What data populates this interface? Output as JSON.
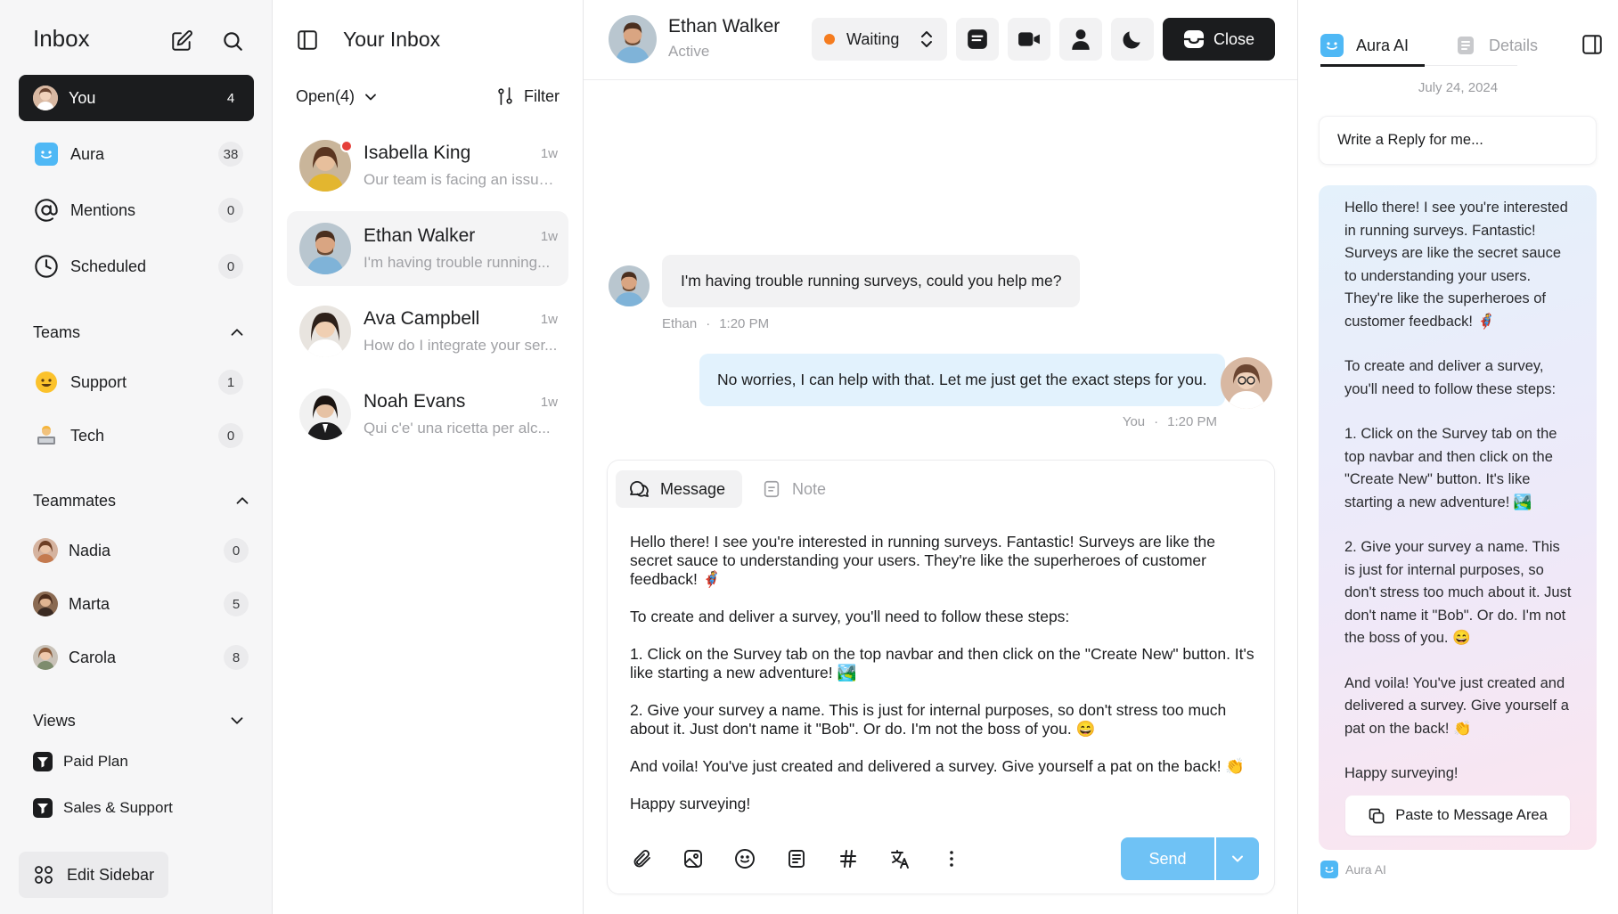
{
  "sidebar": {
    "title": "Inbox",
    "items": [
      {
        "label": "You",
        "count": "4"
      },
      {
        "label": "Aura",
        "count": "38"
      },
      {
        "label": "Mentions",
        "count": "0"
      },
      {
        "label": "Scheduled",
        "count": "0"
      }
    ],
    "teams_label": "Teams",
    "teams": [
      {
        "label": "Support",
        "count": "1"
      },
      {
        "label": "Tech",
        "count": "0"
      }
    ],
    "teammates_label": "Teammates",
    "teammates": [
      {
        "label": "Nadia",
        "count": "0"
      },
      {
        "label": "Marta",
        "count": "5"
      },
      {
        "label": "Carola",
        "count": "8"
      }
    ],
    "views_label": "Views",
    "views": [
      {
        "label": "Paid Plan"
      },
      {
        "label": "Sales & Support"
      }
    ],
    "edit_label": "Edit Sidebar"
  },
  "inbox": {
    "title": "Your Inbox",
    "filter_select": "Open(4)",
    "filter_label": "Filter",
    "conversations": [
      {
        "name": "Isabella King",
        "time": "1w",
        "preview": "Our team is facing an issue..."
      },
      {
        "name": "Ethan Walker",
        "time": "1w",
        "preview": "I'm having trouble running..."
      },
      {
        "name": "Ava Campbell",
        "time": "1w",
        "preview": "How do I integrate your ser..."
      },
      {
        "name": "Noah Evans",
        "time": "1w",
        "preview": "Qui c'e' una ricetta per alc..."
      }
    ]
  },
  "conversation": {
    "contact_name": "Ethan Walker",
    "contact_status": "Active",
    "status_select": "Waiting",
    "close_label": "Close",
    "messages": [
      {
        "text": "I'm having trouble running surveys, could you help me?",
        "sender": "Ethan",
        "time": "1:20 PM"
      },
      {
        "text": "No worries, I can help with that. Let me just get the exact steps for you.",
        "sender": "You",
        "time": "1:20 PM"
      }
    ],
    "meta_separator": "·",
    "composer": {
      "tab_message": "Message",
      "tab_note": "Note",
      "paragraphs": [
        "Hello there! I see you're interested in running surveys. Fantastic! Surveys are like the secret sauce to understanding your users. They're like the superheroes of customer feedback! 🦸",
        "To create and deliver a survey, you'll need to follow these steps:",
        "1. Click on the Survey tab on the top navbar and then click on the \"Create New\" button. It's like starting a new adventure! 🏞️",
        "2. Give your survey a name. This is just for internal purposes, so don't stress too much about it. Just don't name it \"Bob\". Or do. I'm not the boss of you. 😄",
        "And voila! You've just created and delivered a survey. Give yourself a pat on the back! 👏",
        "Happy surveying!"
      ],
      "send_label": "Send"
    }
  },
  "aura": {
    "tab_ai": "Aura AI",
    "tab_details": "Details",
    "date": "July 24, 2024",
    "reply_prompt": "Write a Reply for me...",
    "paragraphs": [
      "Hello there! I see you're interested in running surveys. Fantastic! Surveys are like the secret sauce to understanding your users. They're like the superheroes of customer feedback! 🦸",
      "To create and deliver a survey, you'll need to follow these steps:",
      "1. Click on the Survey tab on the top navbar and then click on the \"Create New\" button. It's like starting a new adventure! 🏞️",
      "2. Give your survey a name. This is just for internal purposes, so don't stress too much about it. Just don't name it \"Bob\". Or do. I'm not the boss of you. 😄",
      "And voila! You've just created and delivered a survey. Give yourself a pat on the back! 👏",
      "Happy surveying!"
    ],
    "paste_label": "Paste to Message Area",
    "footer_label": "Aura AI"
  },
  "colors": {
    "accent_dark": "#1b1c1e",
    "aura_blue": "#4fb8f5",
    "waiting_orange": "#f57c1f",
    "send_blue": "#6fc2f5",
    "unread_red": "#e5403a",
    "outgoing_bubble": "#e2f2fd"
  }
}
